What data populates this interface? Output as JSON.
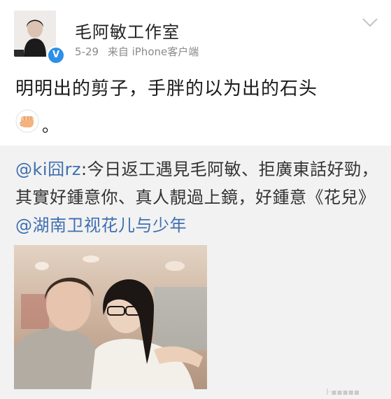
{
  "post": {
    "author": "毛阿敏工作室",
    "date": "5-29",
    "source": "来自 iPhone客户端",
    "text": "明明出的剪子，手胖的以为出的石头",
    "end_punct": "。",
    "verified_mark": "V",
    "avatar_icon": "avatar-portrait",
    "fist_icon": "fist-emoji-icon",
    "menu_icon": "chevron-down-icon"
  },
  "repost": {
    "mention_user": "@ki囧rz",
    "text": ":今日返工遇見毛阿敏、拒廣東話好勁，其實好鍾意你、真人靚過上鏡，好鍾意《花兒》",
    "mention_show": "@湖南卫视花儿与少年",
    "watermark": "Ⅰ·▪▪▪▪▪"
  },
  "colors": {
    "mention": "#3f6fb0",
    "verified": "#2b90e6",
    "repost_bg": "#f2f2f2"
  }
}
